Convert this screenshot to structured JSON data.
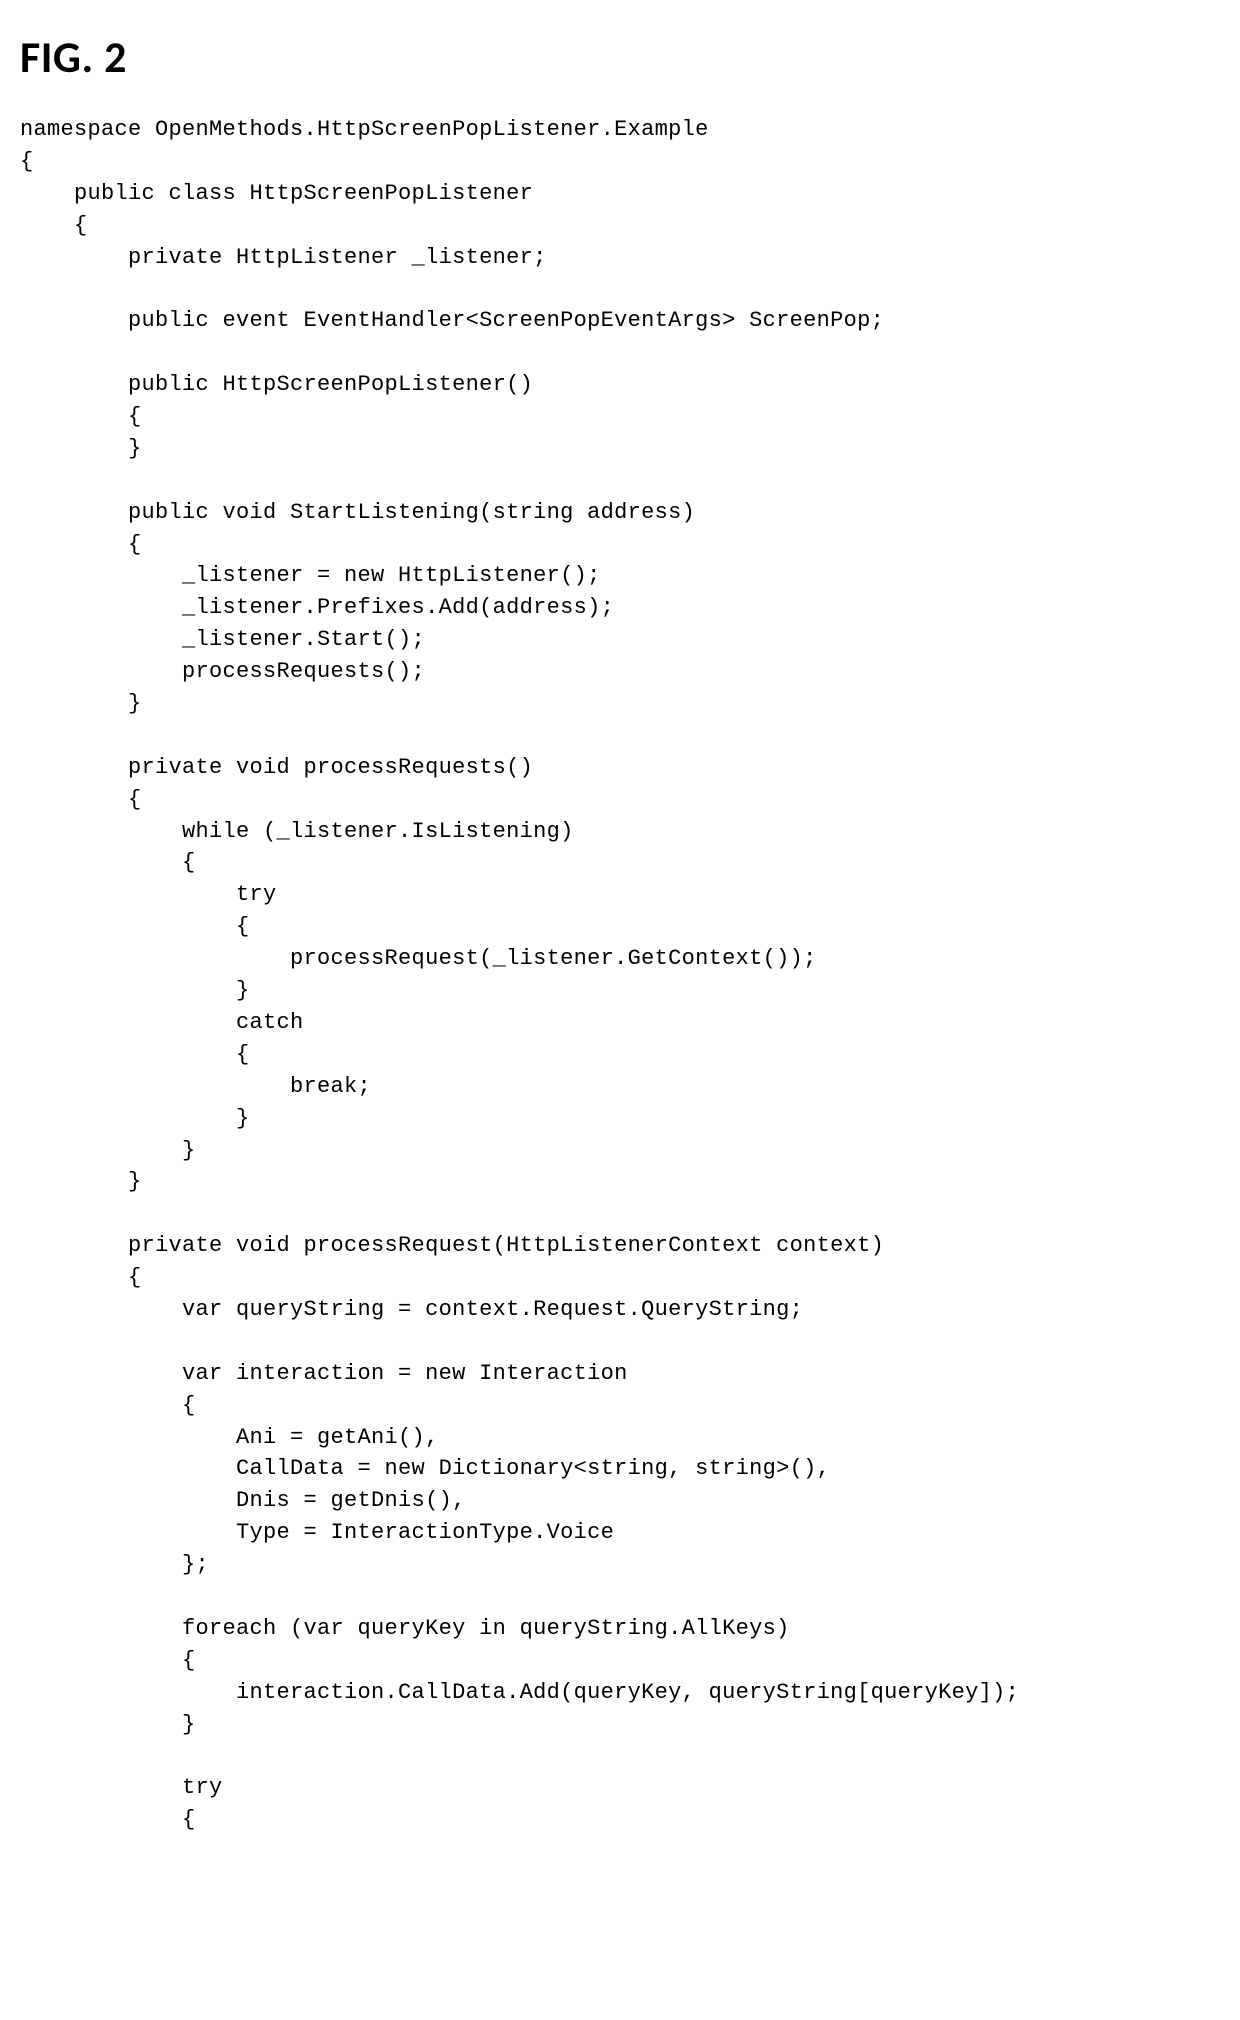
{
  "figure_label": "FIG. 2",
  "code_lines": [
    "namespace OpenMethods.HttpScreenPopListener.Example",
    "{",
    "    public class HttpScreenPopListener",
    "    {",
    "        private HttpListener _listener;",
    "",
    "        public event EventHandler<ScreenPopEventArgs> ScreenPop;",
    "",
    "        public HttpScreenPopListener()",
    "        {",
    "        }",
    "",
    "        public void StartListening(string address)",
    "        {",
    "            _listener = new HttpListener();",
    "            _listener.Prefixes.Add(address);",
    "            _listener.Start();",
    "            processRequests();",
    "        }",
    "",
    "        private void processRequests()",
    "        {",
    "            while (_listener.IsListening)",
    "            {",
    "                try",
    "                {",
    "                    processRequest(_listener.GetContext());",
    "                }",
    "                catch",
    "                {",
    "                    break;",
    "                }",
    "            }",
    "        }",
    "",
    "        private void processRequest(HttpListenerContext context)",
    "        {",
    "            var queryString = context.Request.QueryString;",
    "",
    "            var interaction = new Interaction",
    "            {",
    "                Ani = getAni(),",
    "                CallData = new Dictionary<string, string>(),",
    "                Dnis = getDnis(),",
    "                Type = InteractionType.Voice",
    "            };",
    "",
    "            foreach (var queryKey in queryString.AllKeys)",
    "            {",
    "                interaction.CallData.Add(queryKey, queryString[queryKey]);",
    "            }",
    "",
    "            try",
    "            {"
  ]
}
